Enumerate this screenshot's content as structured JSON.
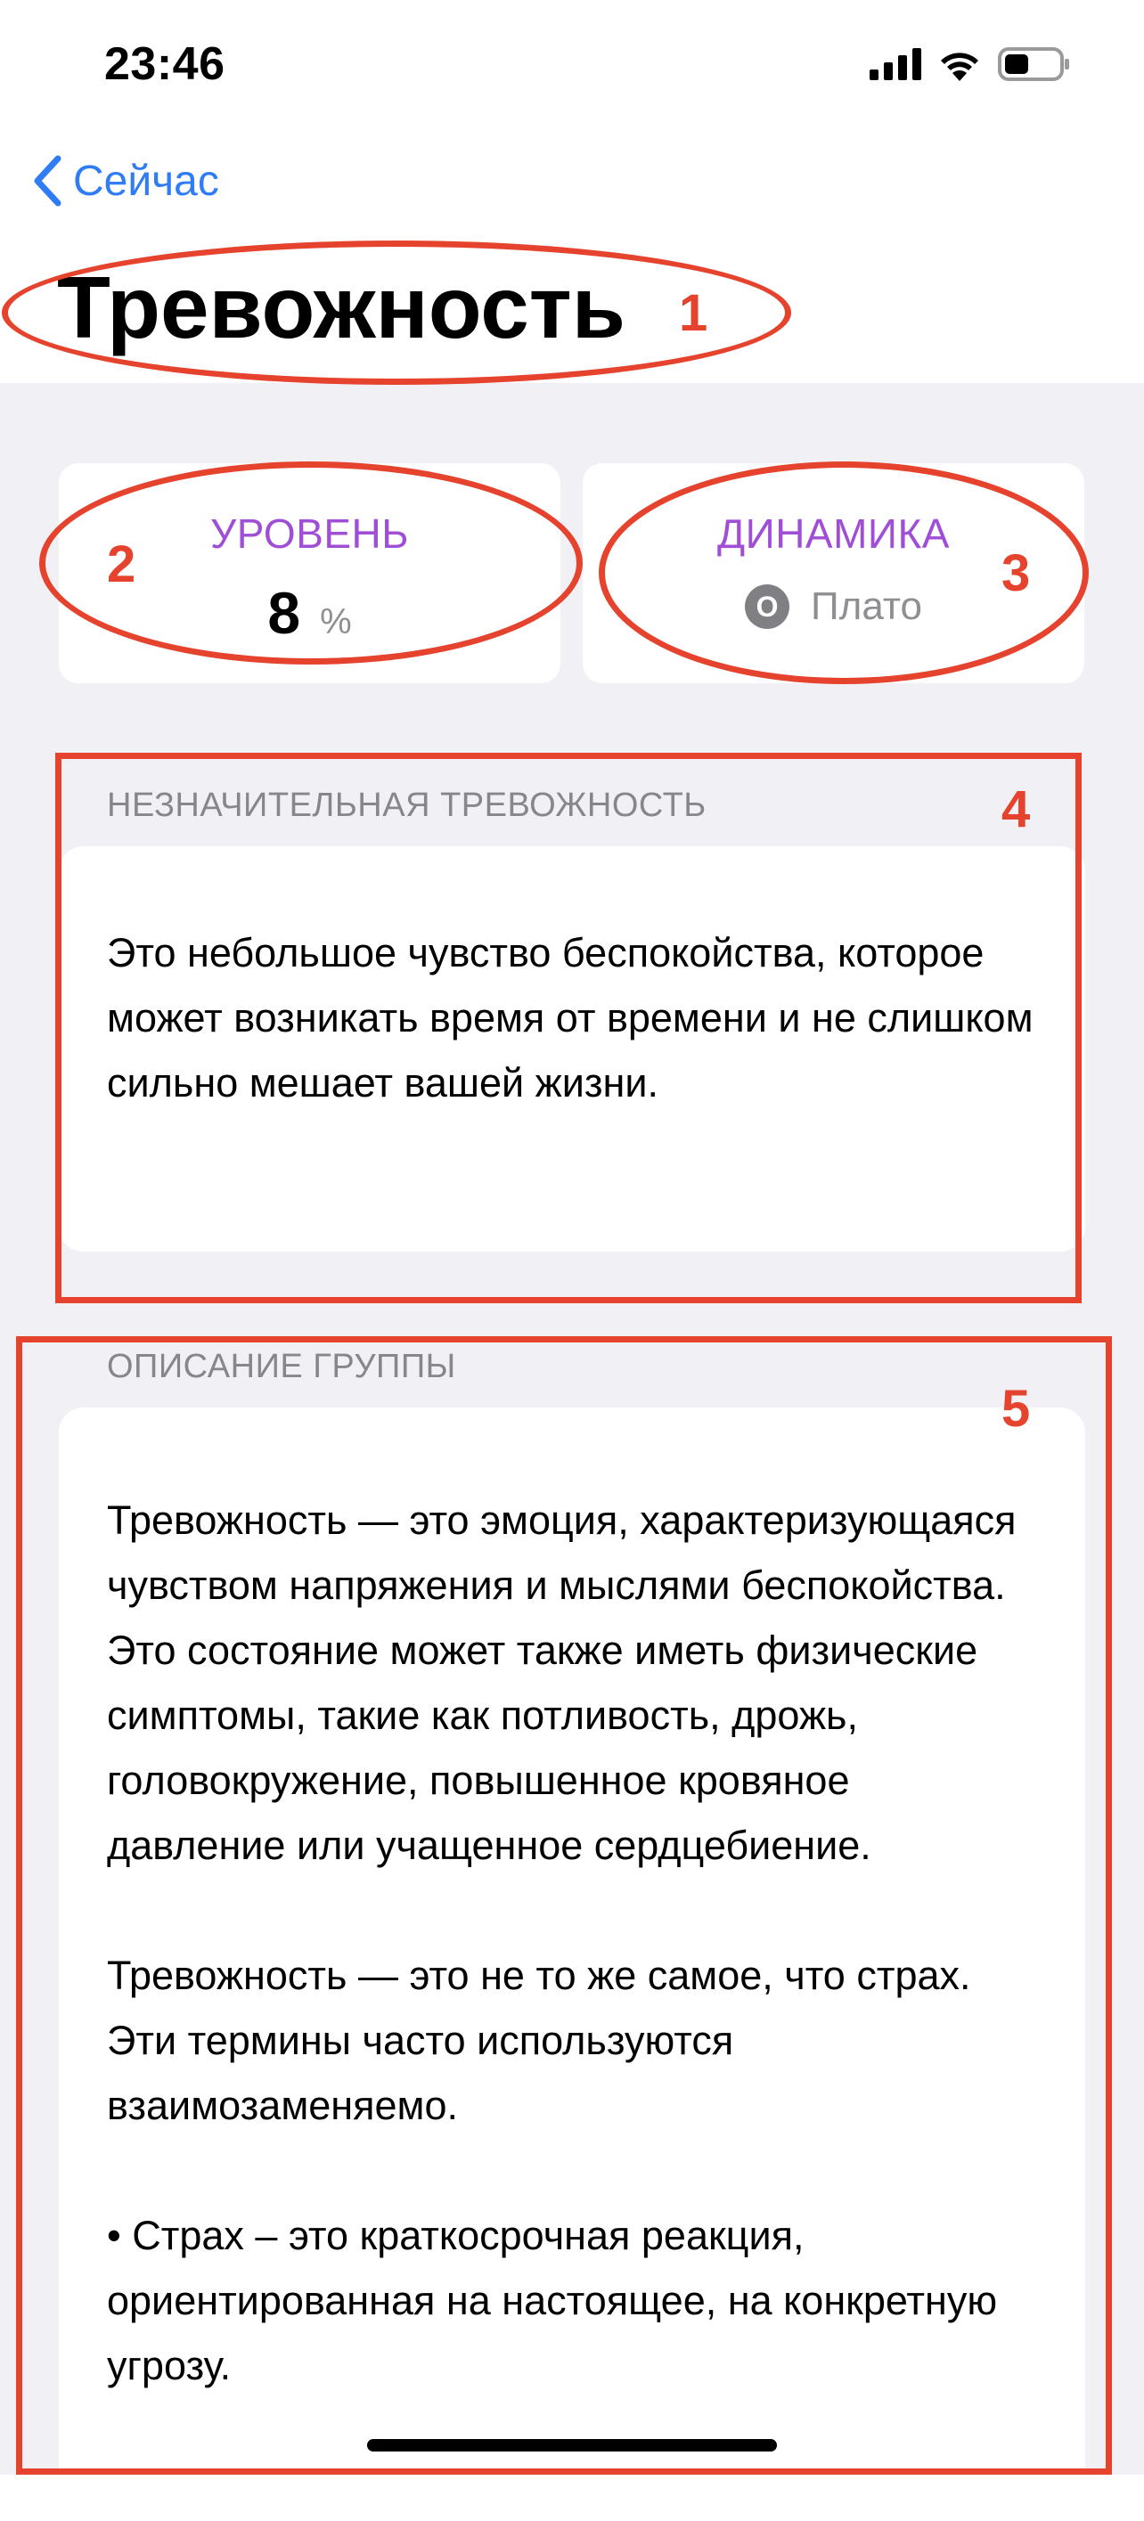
{
  "status_bar": {
    "time": "23:46"
  },
  "nav": {
    "back_label": "Сейчас"
  },
  "page": {
    "title": "Тревожность"
  },
  "stats": {
    "level": {
      "label": "УРОВЕНЬ",
      "value": "8",
      "unit": "%"
    },
    "dynamics": {
      "label": "ДИНАМИКА",
      "icon_glyph": "О",
      "value": "Плато"
    }
  },
  "severity_section": {
    "header": "НЕЗНАЧИТЕЛЬНАЯ ТРЕВОЖНОСТЬ",
    "text": "Это небольшое чувство беспокойства, которое может возникать время от времени и не слишком сильно мешает вашей жизни."
  },
  "group_section": {
    "header": "ОПИСАНИЕ ГРУППЫ",
    "paragraphs": [
      "Тревожность — это эмоция, характеризующаяся чувством напряжения и мыслями беспокойства. Это состояние может также иметь физические симптомы, такие как потливость, дрожь, головокружение, повышенное кровяное давление или учащенное сердцебиение.",
      "Тревожность — это не то же самое, что страх. Эти термины часто используются взаимозаменяемо.",
      "• Страх – это краткосрочная реакция, ориентированная на настоящее, на конкретную угрозу."
    ]
  },
  "annotations": [
    "1",
    "2",
    "3",
    "4",
    "5"
  ],
  "colors": {
    "accent": "#2f7cf6",
    "stat_label": "#a04ed6",
    "annotation": "#e5432d",
    "background": "#f1f1f5"
  }
}
